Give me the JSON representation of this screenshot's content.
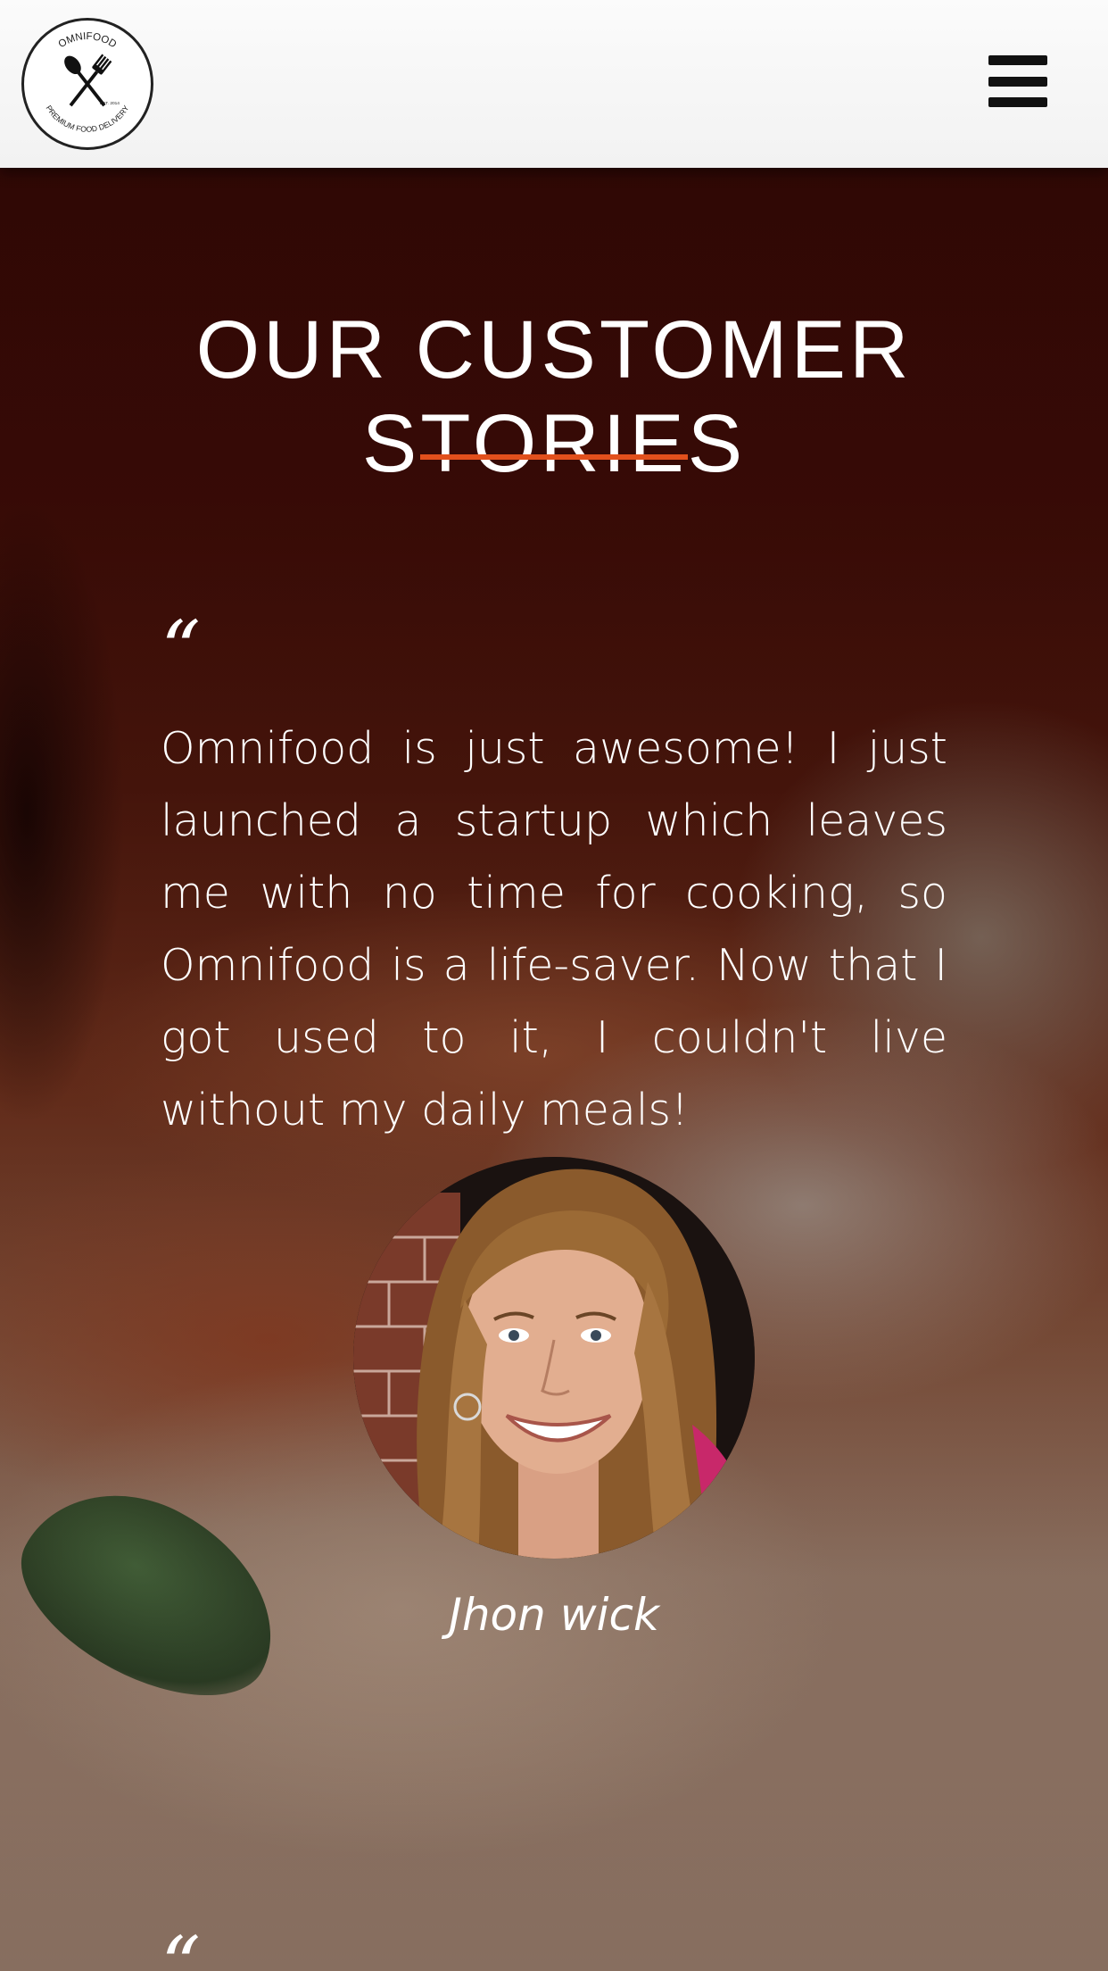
{
  "header": {
    "logo_alt": "Omnifood logo",
    "logo_text_top": "OMNIFOOD",
    "logo_text_bottom": "PREMIUM FOOD DELIVERY",
    "logo_est": "EST. 2014",
    "menu_icon": "hamburger-menu-icon"
  },
  "testimonials": {
    "title": "OUR CUSTOMER STORIES",
    "accent_color": "#e2501c",
    "items": [
      {
        "quote_mark": "“",
        "text": "Omnifood is just awesome! I just launched a startup which leaves me with no time for cooking, so Omnifood is a life-saver. Now that I got used to it, I couldn't live without my daily meals!",
        "author": "Jhon wick"
      },
      {
        "quote_mark": "“"
      }
    ]
  }
}
